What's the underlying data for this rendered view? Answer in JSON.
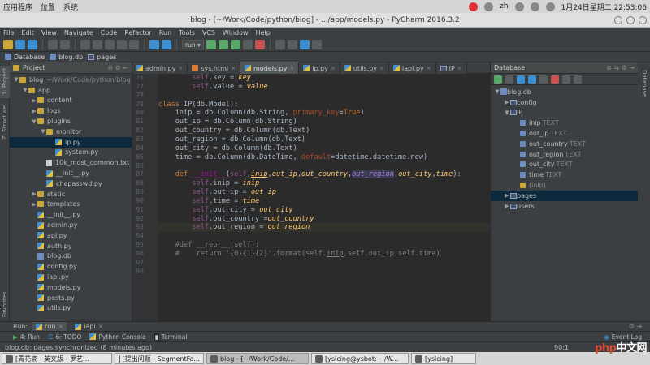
{
  "system_bar": {
    "menu": [
      "应用程序",
      "位置",
      "系统"
    ],
    "input": "zh",
    "datetime": "1月24日星期二 22:53:06"
  },
  "window": {
    "title": "blog - [~/Work/Code/python/blog] - .../app/models.py - PyCharm 2016.3.2"
  },
  "menubar": [
    "File",
    "Edit",
    "View",
    "Navigate",
    "Code",
    "Refactor",
    "Run",
    "Tools",
    "VCS",
    "Window",
    "Help"
  ],
  "toolbar": {
    "run_config": "run"
  },
  "navbar": {
    "items": [
      "Database",
      "blog.db",
      "pages"
    ]
  },
  "project_panel": {
    "header": "Project",
    "tree": [
      {
        "label": "blog",
        "suffix": "~/Work/Code/python/blog",
        "indent": 0,
        "type": "folder",
        "open": true
      },
      {
        "label": "app",
        "indent": 1,
        "type": "folder",
        "open": true
      },
      {
        "label": "content",
        "indent": 2,
        "type": "folder",
        "open": false
      },
      {
        "label": "logs",
        "indent": 2,
        "type": "folder",
        "open": false
      },
      {
        "label": "plugins",
        "indent": 2,
        "type": "folder",
        "open": true
      },
      {
        "label": "monitor",
        "indent": 3,
        "type": "folder",
        "open": true
      },
      {
        "label": "ip.py",
        "indent": 4,
        "type": "py",
        "selected": true
      },
      {
        "label": "system.py",
        "indent": 4,
        "type": "py"
      },
      {
        "label": "10k_most_common.txt",
        "indent": 3,
        "type": "txt"
      },
      {
        "label": "__init__.py",
        "indent": 3,
        "type": "py"
      },
      {
        "label": "chepasswd.py",
        "indent": 3,
        "type": "py"
      },
      {
        "label": "static",
        "indent": 2,
        "type": "folder",
        "open": false
      },
      {
        "label": "templates",
        "indent": 2,
        "type": "folder",
        "open": false
      },
      {
        "label": "__init__.py",
        "indent": 2,
        "type": "py"
      },
      {
        "label": "admin.py",
        "indent": 2,
        "type": "py"
      },
      {
        "label": "api.py",
        "indent": 2,
        "type": "py"
      },
      {
        "label": "auth.py",
        "indent": 2,
        "type": "py"
      },
      {
        "label": "blog.db",
        "indent": 2,
        "type": "db"
      },
      {
        "label": "config.py",
        "indent": 2,
        "type": "py"
      },
      {
        "label": "iapi.py",
        "indent": 2,
        "type": "py"
      },
      {
        "label": "models.py",
        "indent": 2,
        "type": "py"
      },
      {
        "label": "posts.py",
        "indent": 2,
        "type": "py"
      },
      {
        "label": "utils.py",
        "indent": 2,
        "type": "py"
      }
    ]
  },
  "side_tabs_left": [
    "1: Project",
    "Z: Structure",
    "Favorites"
  ],
  "side_tabs_right": [
    "Database"
  ],
  "editor": {
    "tabs": [
      {
        "label": "admin.py",
        "type": "py"
      },
      {
        "label": "sys.html",
        "type": "html"
      },
      {
        "label": "models.py",
        "type": "py",
        "active": true
      },
      {
        "label": "ip.py",
        "type": "py"
      },
      {
        "label": "utils.py",
        "type": "py"
      },
      {
        "label": "iapi.py",
        "type": "py"
      },
      {
        "label": "IP",
        "type": "table"
      }
    ],
    "line_numbers": [
      "76",
      "77",
      "78",
      "79",
      "80",
      "81",
      "82",
      "83",
      "84",
      "85",
      "86",
      "87",
      "88",
      "89",
      "90",
      "91",
      "92",
      "93",
      "94",
      "95",
      "96",
      "97",
      "98"
    ]
  },
  "database_panel": {
    "header": "Database",
    "tree": [
      {
        "label": "blog.db",
        "indent": 0,
        "type": "db",
        "open": true
      },
      {
        "label": "config",
        "indent": 1,
        "type": "table",
        "open": false
      },
      {
        "label": "IP",
        "indent": 1,
        "type": "table",
        "open": true
      },
      {
        "label": "inip",
        "ctype": "TEXT",
        "indent": 2,
        "type": "col"
      },
      {
        "label": "out_ip",
        "ctype": "TEXT",
        "indent": 2,
        "type": "col"
      },
      {
        "label": "out_country",
        "ctype": "TEXT",
        "indent": 2,
        "type": "col"
      },
      {
        "label": "out_region",
        "ctype": "TEXT",
        "indent": 2,
        "type": "col"
      },
      {
        "label": "out_city",
        "ctype": "TEXT",
        "indent": 2,
        "type": "col"
      },
      {
        "label": "time",
        "ctype": "TEXT",
        "indent": 2,
        "type": "col"
      },
      {
        "label": "(inip)",
        "indent": 2,
        "type": "key"
      },
      {
        "label": "pages",
        "indent": 1,
        "type": "table",
        "open": false,
        "selected": true
      },
      {
        "label": "users",
        "indent": 1,
        "type": "table",
        "open": false
      }
    ]
  },
  "run_bar": {
    "label": "Run:",
    "tabs": [
      "run",
      "iapi"
    ]
  },
  "bottom_tabs": [
    "4: Run",
    "6: TODO",
    "Python Console",
    "Terminal"
  ],
  "event_log": "Event Log",
  "status": {
    "message": "blog.db: pages synchronized (8 minutes ago)",
    "position": "90:1"
  },
  "taskbar": [
    {
      "label": "[青花瓷 - 英文版 - 罗艺..."
    },
    {
      "label": "[提出问题 - SegmentFa..."
    },
    {
      "label": "blog - [~/Work/Code/...",
      "active": true
    },
    {
      "label": "[ysicing@ysbot: ~/W..."
    },
    {
      "label": "[ysicing]"
    }
  ],
  "watermark": {
    "a": "php",
    "b": "中文网"
  }
}
